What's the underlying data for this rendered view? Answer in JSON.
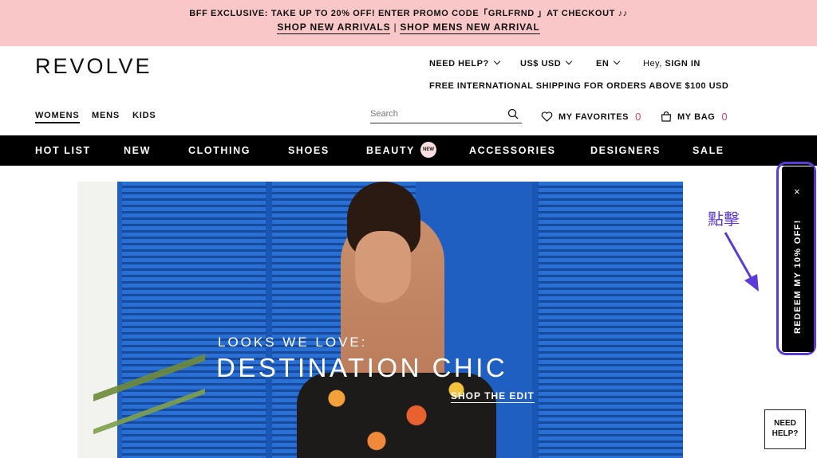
{
  "promo": {
    "line1": "BFF EXCLUSIVE: TAKE UP TO 20% OFF! ENTER PROMO CODE「GRLFRND 」AT CHECKOUT ♪♪",
    "link1": "SHOP NEW ARRIVALS",
    "separator": "|",
    "link2": "SHOP MENS NEW ARRIVAL"
  },
  "header": {
    "logo": "REVOLVE",
    "need_help": "NEED HELP?",
    "currency": "US$ USD",
    "language": "EN",
    "hey": "Hey,",
    "sign_in": "SIGN IN",
    "shipping": "FREE INTERNATIONAL SHIPPING FOR ORDERS ABOVE $100 USD",
    "genders": [
      "WOMENS",
      "MENS",
      "KIDS"
    ],
    "search_placeholder": "Search",
    "favorites_label": "MY FAVORITES",
    "favorites_count": "0",
    "bag_label": "MY BAG",
    "bag_count": "0"
  },
  "nav": {
    "items": [
      "HOT LIST",
      "NEW",
      "CLOTHING",
      "SHOES",
      "BEAUTY",
      "ACCESSORIES",
      "DESIGNERS",
      "SALE"
    ],
    "beauty_badge": "NEW"
  },
  "hero": {
    "eyebrow": "LOOKS WE LOVE:",
    "headline": "DESTINATION CHIC",
    "cta": "SHOP THE EDIT"
  },
  "redeem": {
    "label": "REDEEM MY 10% OFF!",
    "close": "×"
  },
  "annotation": {
    "text": "點擊",
    "color": "#5c3ad6"
  },
  "help_widget": {
    "label_line1": "NEED",
    "label_line2": "HELP?"
  },
  "colors": {
    "promo_bg": "#f9c7c8",
    "accent_pink": "#e53a6a",
    "nav_bg": "#000000",
    "annotation": "#5c3ad6"
  }
}
